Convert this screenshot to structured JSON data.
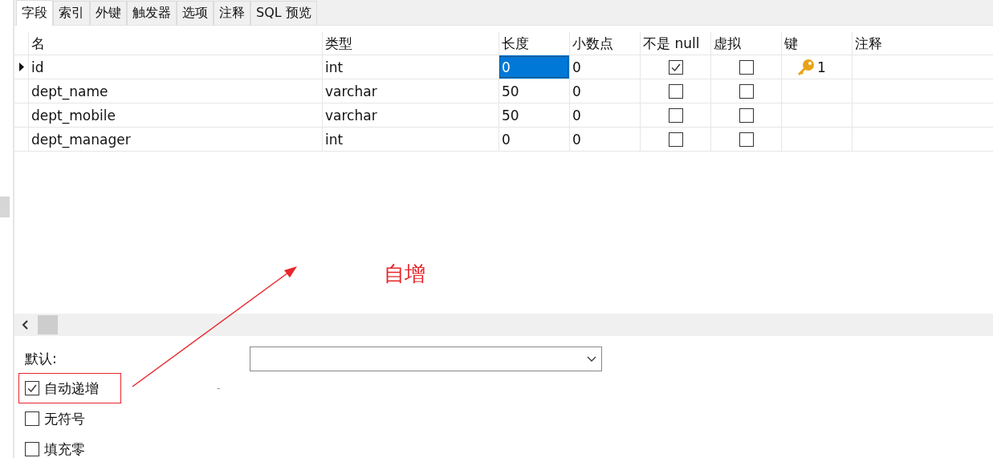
{
  "tabs": [
    {
      "label": "字段",
      "selected": true
    },
    {
      "label": "索引",
      "selected": false
    },
    {
      "label": "外键",
      "selected": false
    },
    {
      "label": "触发器",
      "selected": false
    },
    {
      "label": "选项",
      "selected": false
    },
    {
      "label": "注释",
      "selected": false
    },
    {
      "label": "SQL 预览",
      "selected": false
    }
  ],
  "table": {
    "columns": [
      "名",
      "类型",
      "长度",
      "小数点",
      "不是 null",
      "虚拟",
      "键",
      "注释"
    ],
    "rows": [
      {
        "name": "id",
        "type": "int",
        "length": "0",
        "decimals": "0",
        "not_null": true,
        "virtual": false,
        "key": "1",
        "selected": true
      },
      {
        "name": "dept_name",
        "type": "varchar",
        "length": "50",
        "decimals": "0",
        "not_null": false,
        "virtual": false,
        "selected": false
      },
      {
        "name": "dept_mobile",
        "type": "varchar",
        "length": "50",
        "decimals": "0",
        "not_null": false,
        "virtual": false,
        "selected": false
      },
      {
        "name": "dept_manager",
        "type": "int",
        "length": "0",
        "decimals": "0",
        "not_null": false,
        "virtual": false,
        "selected": false
      }
    ]
  },
  "properties": {
    "default_label": "默认:",
    "dash": "-",
    "options": [
      {
        "label": "自动递增",
        "checked": true
      },
      {
        "label": "无符号",
        "checked": false
      },
      {
        "label": "填充零",
        "checked": false
      }
    ]
  },
  "annotation": {
    "label": "自增"
  }
}
